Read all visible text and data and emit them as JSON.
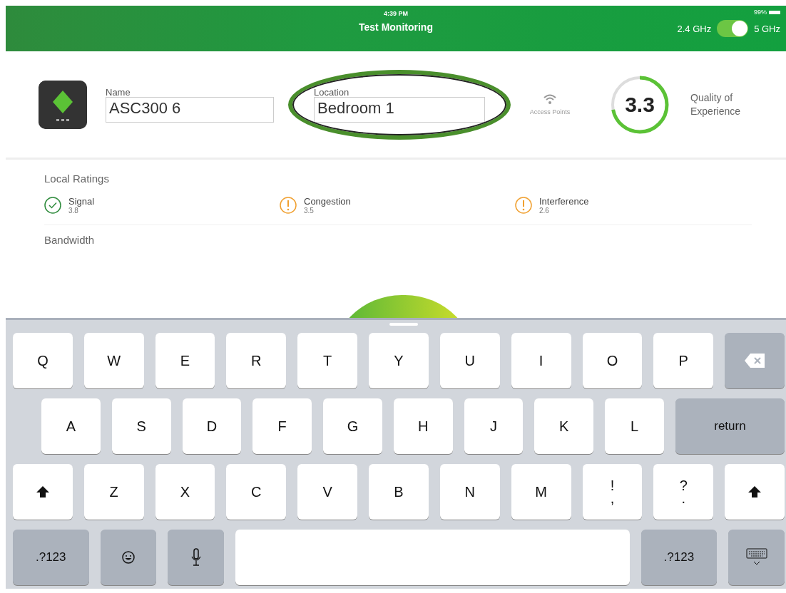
{
  "status_bar": {
    "time": "4:39 PM",
    "battery": "99%"
  },
  "header": {
    "title": "Test Monitoring",
    "band_left": "2.4 GHz",
    "band_right": "5 GHz",
    "band_toggle_on": true
  },
  "device": {
    "name_label": "Name",
    "name_value": "ASC300 6",
    "location_label": "Location",
    "location_value": "Bedroom 1",
    "location_highlighted": true,
    "access_points_label": "Access Points",
    "quality": {
      "score": "3.3",
      "level": 0.72,
      "label": "Quality of Experience"
    }
  },
  "local_ratings": {
    "title": "Local Ratings",
    "items": [
      {
        "kind": "ok",
        "name": "Signal",
        "value": "3.8"
      },
      {
        "kind": "warn",
        "name": "Congestion",
        "value": "3.5"
      },
      {
        "kind": "warn",
        "name": "Interference",
        "value": "2.6"
      }
    ]
  },
  "bandwidth": {
    "title": "Bandwidth"
  },
  "keyboard": {
    "rows": [
      {
        "keys": [
          {
            "kind": "char",
            "label": "Q"
          },
          {
            "kind": "char",
            "label": "W"
          },
          {
            "kind": "char",
            "label": "E"
          },
          {
            "kind": "char",
            "label": "R"
          },
          {
            "kind": "char",
            "label": "T"
          },
          {
            "kind": "char",
            "label": "Y"
          },
          {
            "kind": "char",
            "label": "U"
          },
          {
            "kind": "char",
            "label": "I"
          },
          {
            "kind": "char",
            "label": "O"
          },
          {
            "kind": "char",
            "label": "P"
          },
          {
            "kind": "backspace"
          }
        ]
      },
      {
        "keys": [
          {
            "kind": "char",
            "label": "A"
          },
          {
            "kind": "char",
            "label": "S"
          },
          {
            "kind": "char",
            "label": "D"
          },
          {
            "kind": "char",
            "label": "F"
          },
          {
            "kind": "char",
            "label": "G"
          },
          {
            "kind": "char",
            "label": "H"
          },
          {
            "kind": "char",
            "label": "J"
          },
          {
            "kind": "char",
            "label": "K"
          },
          {
            "kind": "char",
            "label": "L"
          },
          {
            "kind": "return",
            "label": "return"
          }
        ]
      },
      {
        "keys": [
          {
            "kind": "shift"
          },
          {
            "kind": "char",
            "label": "Z"
          },
          {
            "kind": "char",
            "label": "X"
          },
          {
            "kind": "char",
            "label": "C"
          },
          {
            "kind": "char",
            "label": "V"
          },
          {
            "kind": "char",
            "label": "B"
          },
          {
            "kind": "char",
            "label": "N"
          },
          {
            "kind": "char",
            "label": "M"
          },
          {
            "kind": "dual",
            "label": "!",
            "sub": ","
          },
          {
            "kind": "dual",
            "label": "?",
            "sub": "."
          },
          {
            "kind": "shift"
          }
        ]
      },
      {
        "keys": [
          {
            "kind": "mode",
            "label": ".?123"
          },
          {
            "kind": "emoji"
          },
          {
            "kind": "mic"
          },
          {
            "kind": "space"
          },
          {
            "kind": "mode",
            "label": ".?123"
          },
          {
            "kind": "hide"
          }
        ]
      }
    ]
  }
}
